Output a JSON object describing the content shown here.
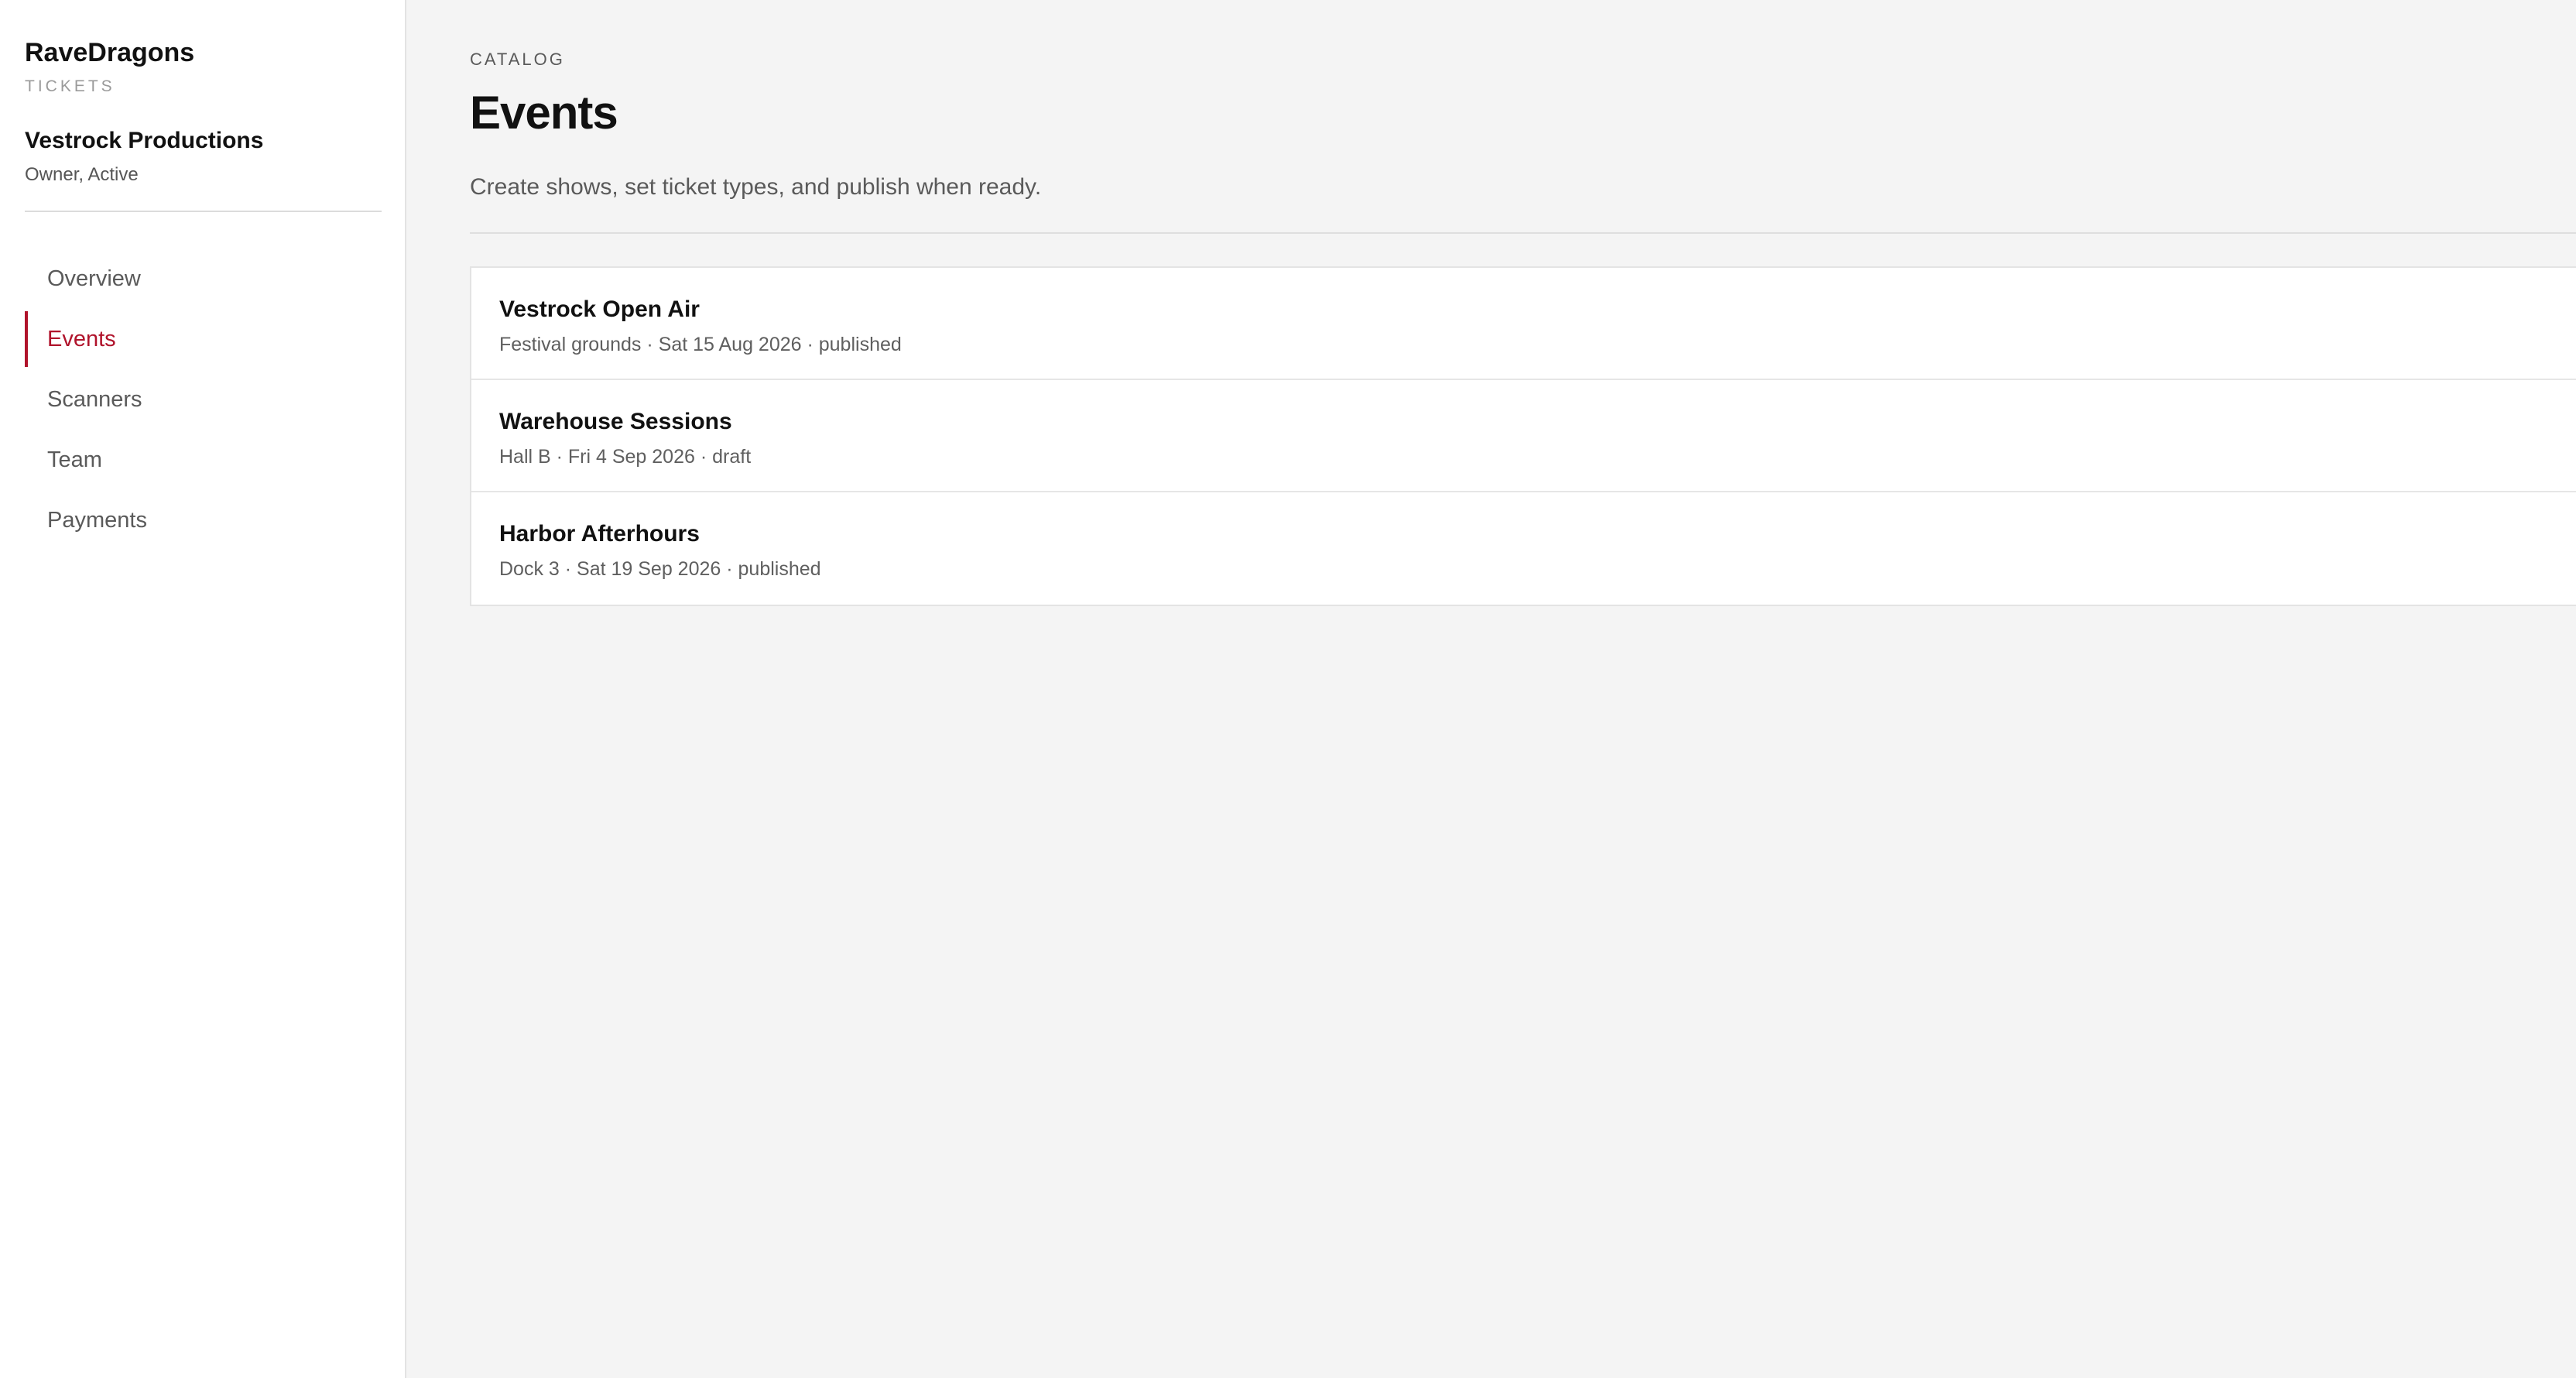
{
  "brand": {
    "name": "RaveDragons",
    "subtitle": "TICKETS"
  },
  "organization": {
    "name": "Vestrock Productions",
    "role": "Owner, Active"
  },
  "nav": {
    "items": [
      {
        "label": "Overview",
        "active": false
      },
      {
        "label": "Events",
        "active": true
      },
      {
        "label": "Scanners",
        "active": false
      },
      {
        "label": "Team",
        "active": false
      },
      {
        "label": "Payments",
        "active": false
      }
    ]
  },
  "header": {
    "eyebrow": "CATALOG",
    "title": "Events",
    "description": "Create shows, set ticket types, and publish when ready."
  },
  "events": [
    {
      "name": "Vestrock Open Air",
      "meta": "Festival grounds · Sat 15 Aug 2026 · published"
    },
    {
      "name": "Warehouse Sessions",
      "meta": "Hall B · Fri 4 Sep 2026 · draft"
    },
    {
      "name": "Harbor Afterhours",
      "meta": "Dock 3 · Sat 19 Sep 2026 · published"
    }
  ],
  "colors": {
    "accent": "#b0132b",
    "background": "#f4f4f4",
    "sidebar": "#ffffff"
  }
}
